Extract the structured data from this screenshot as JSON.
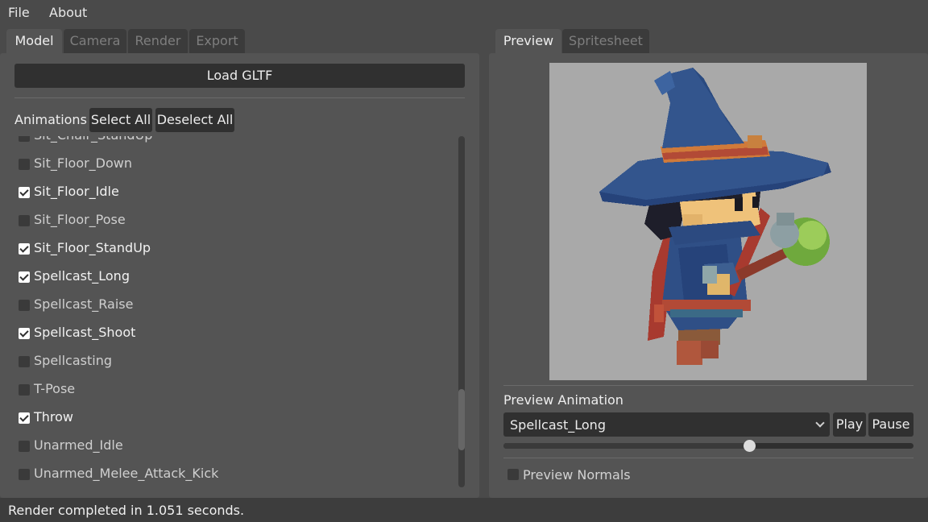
{
  "menu": {
    "file": "File",
    "about": "About"
  },
  "left_tabs": [
    {
      "label": "Model",
      "active": true
    },
    {
      "label": "Camera",
      "active": false
    },
    {
      "label": "Render",
      "active": false
    },
    {
      "label": "Export",
      "active": false
    }
  ],
  "right_tabs": [
    {
      "label": "Preview",
      "active": true
    },
    {
      "label": "Spritesheet",
      "active": false
    }
  ],
  "model": {
    "load_label": "Load GLTF",
    "animations_label": "Animations",
    "select_all_label": "Select All",
    "deselect_all_label": "Deselect All",
    "animations": [
      {
        "name": "Sit_Chair_StandUp",
        "checked": false
      },
      {
        "name": "Sit_Floor_Down",
        "checked": false
      },
      {
        "name": "Sit_Floor_Idle",
        "checked": true
      },
      {
        "name": "Sit_Floor_Pose",
        "checked": false
      },
      {
        "name": "Sit_Floor_StandUp",
        "checked": true
      },
      {
        "name": "Spellcast_Long",
        "checked": true
      },
      {
        "name": "Spellcast_Raise",
        "checked": false
      },
      {
        "name": "Spellcast_Shoot",
        "checked": true
      },
      {
        "name": "Spellcasting",
        "checked": false
      },
      {
        "name": "T-Pose",
        "checked": false
      },
      {
        "name": "Throw",
        "checked": true
      },
      {
        "name": "Unarmed_Idle",
        "checked": false
      },
      {
        "name": "Unarmed_Melee_Attack_Kick",
        "checked": false
      }
    ],
    "scroll_position": 0.9
  },
  "preview": {
    "animation_label": "Preview Animation",
    "selected_animation": "Spellcast_Long",
    "play_label": "Play",
    "pause_label": "Pause",
    "progress": 0.6,
    "normals_label": "Preview Normals",
    "normals_checked": false,
    "background_color": "#a9a9a9"
  },
  "status": "Render completed in 1.051 seconds."
}
